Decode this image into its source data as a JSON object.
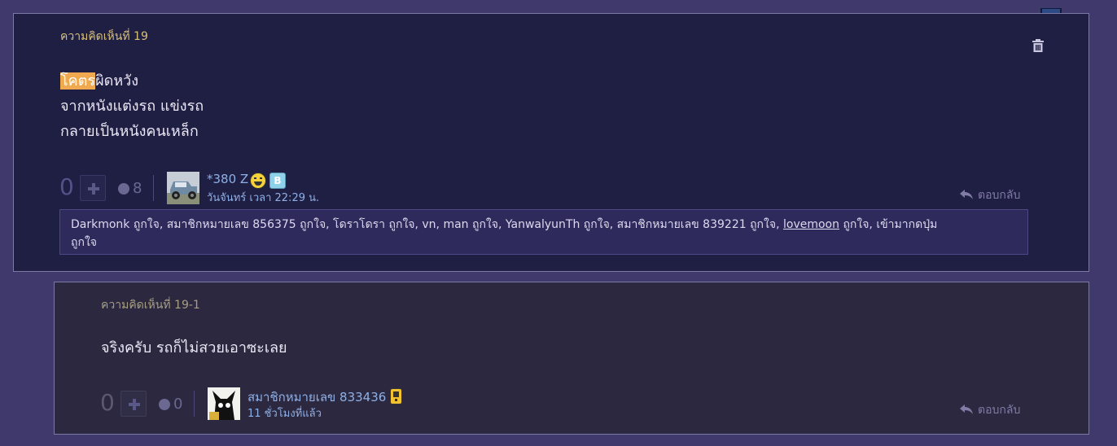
{
  "comment_main": {
    "title": "ความคิดเห็นที่ 19",
    "body_highlight": "โคตร",
    "body_line1_rest": "ผิดหวัง",
    "body_line2": "จากหนังแต่งรถ แข่งรถ",
    "body_line3": "กลายเป็นหนังคนเหล็ก",
    "vote_count": "0",
    "emotion_count": "8",
    "author": "*380 Z",
    "timestamp": "วันจันทร์ เวลา 22:29 น.",
    "reply_label": "ตอบกลับ",
    "likes_text": "Darkmonk ถูกใจ, สมาชิกหมายเลข 856375 ถูกใจ, โดราโดรา ถูกใจ, vn, man ถูกใจ, YanwalyunTh ถูกใจ, สมาชิกหมายเลข 839221 ถูกใจ,",
    "likes_link": "lovemoon",
    "likes_after_link": "ถูกใจ, เข้ามากดปุ่ม",
    "likes_line2": "ถูกใจ"
  },
  "comment_reply": {
    "title": "ความคิดเห็นที่ 19-1",
    "body": "จริงครับ รถก็ไม่สวยเอาซะเลย",
    "vote_count": "0",
    "emotion_count": "0",
    "author": "สมาชิกหมายเลข 833436",
    "timestamp": "11 ชั่วโมงที่แล้ว",
    "reply_label": "ตอบกลับ"
  },
  "icons": {
    "delete": "trash-icon",
    "bookmark": "bookmark-icon",
    "vote": "plus-icon",
    "emotion": "emotion-face-icon",
    "reply": "reply-arrow-icon",
    "badge_smile": "smiley-badge-icon",
    "badge_blog": "blog-badge-icon",
    "badge_phone": "mobile-badge-icon"
  },
  "colors": {
    "page_bg": "#3f3a6b",
    "comment_bg": "#1f1e43",
    "reply_bg": "#2b2840",
    "title_gold": "#d7c07a",
    "highlight": "#f0a94f",
    "link_blue": "#8fb0e6"
  }
}
